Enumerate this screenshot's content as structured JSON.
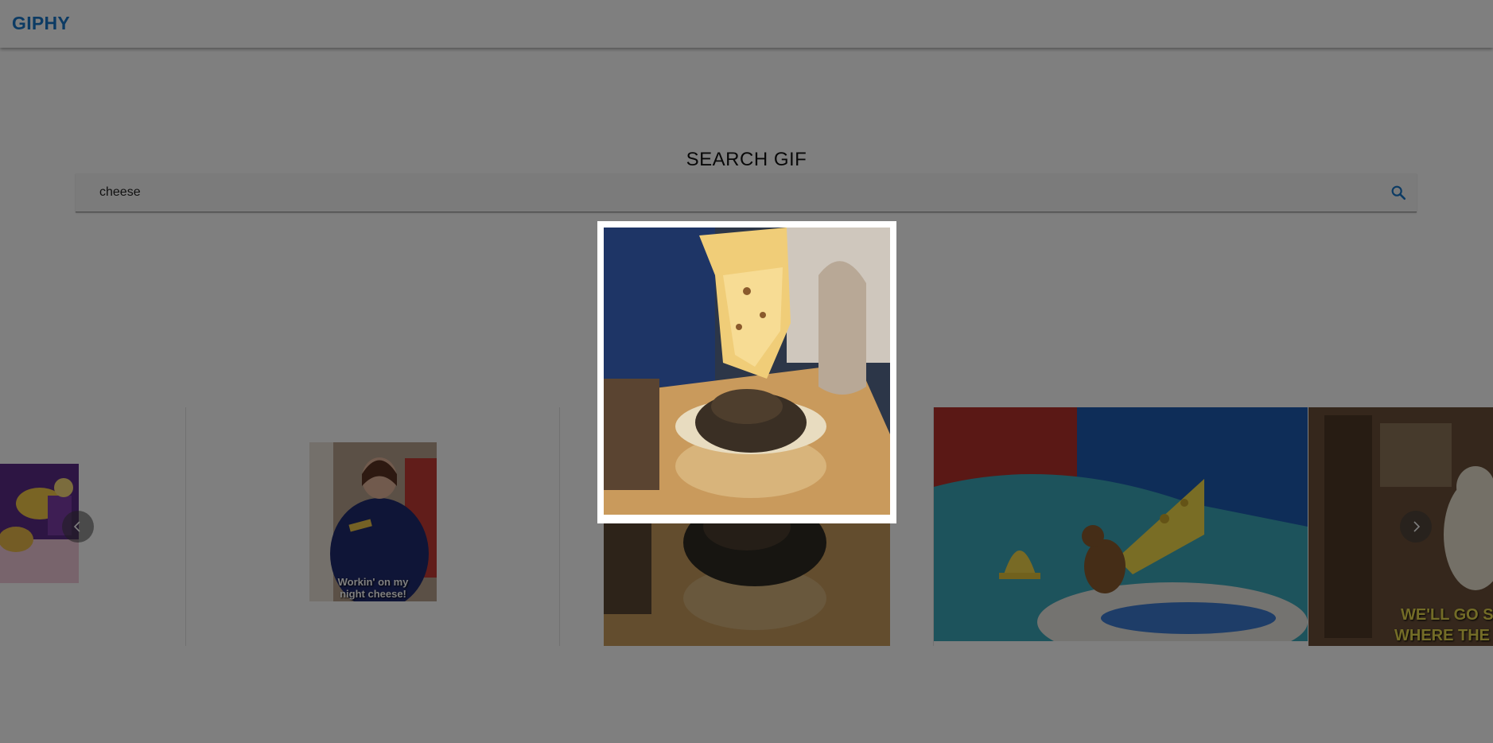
{
  "app": {
    "brand": "GIPHY"
  },
  "search": {
    "title": "SEARCH GIF",
    "query": "cheese",
    "icon": "search-icon",
    "accent": "#1976c8"
  },
  "carousel": {
    "prev_icon": "chevron-left-icon",
    "next_icon": "chevron-right-icon",
    "slides": [
      {
        "caption": ""
      },
      {
        "caption_line1": "Workin' on my",
        "caption_line2": "night cheese!"
      },
      {
        "caption": ""
      },
      {
        "caption": ""
      },
      {
        "caption": "WE'LL GO S",
        "caption2": "WHERE THE"
      }
    ]
  },
  "modal": {
    "visible": true,
    "gif": "melted cheese on burger"
  },
  "colors": {
    "brand": "#1976c8",
    "overlay": "rgba(0,0,0,0.5)"
  }
}
